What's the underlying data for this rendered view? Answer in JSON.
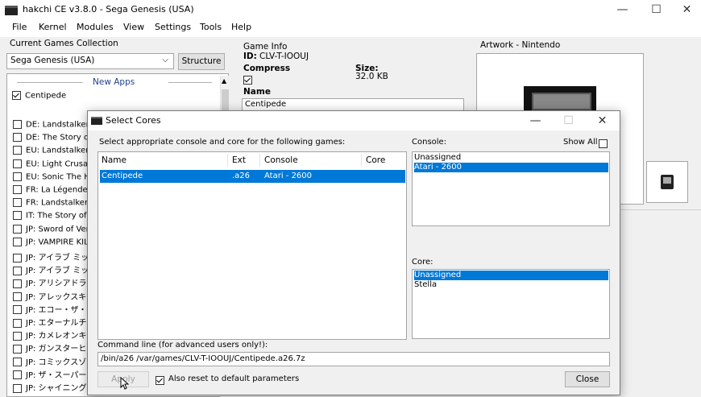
{
  "window": {
    "title": "hakchi CE v3.8.0 - Sega Genesis (USA)",
    "minimize_glyph": "—",
    "maximize_glyph": "☐",
    "close_glyph": "✕"
  },
  "menu": [
    "File",
    "Kernel",
    "Modules",
    "View",
    "Settings",
    "Tools",
    "Help"
  ],
  "collection": {
    "label": "Current Games Collection",
    "selected": "Sega Genesis (USA)",
    "structure_button": "Structure",
    "new_apps_header": "New Apps",
    "new_apps": [
      {
        "name": "Centipede",
        "checked": true
      }
    ],
    "games": [
      "DE: Landstalker",
      "DE: The Story of T",
      "EU: Landstalker",
      "EU: Light Crusade",
      "EU: Sonic The He",
      "FR: La Légende d",
      "FR: Landstalker",
      "IT: The Story of Th",
      "JP: Sword of Verm",
      "JP: VAMPIRE KIL",
      "JP: アイラブ ミッキー",
      "JP: アイラブ ミッキー",
      "JP: アリシアドラグー",
      "JP: アレックスキッド",
      "JP: エコー・ザ・ドル",
      "JP: エターナルチャン",
      "JP: カメレオンキッド",
      "JP: ガンスターヒーロ",
      "JP: コミックスゾーン",
      "JP: ザ・スーパー忍",
      "JP: シャイニング・フ"
    ]
  },
  "game_info": {
    "label": "Game Info",
    "id_label": "ID:",
    "id_value": "CLV-T-IOOUJ",
    "compress_label": "Compress",
    "size_label": "Size:",
    "size_value": "32.0 KB",
    "name_label": "Name",
    "name_value": "Centipede"
  },
  "artwork": {
    "label": "Artwork - Nintendo"
  },
  "dialog": {
    "title": "Select Cores",
    "instruction": "Select appropriate console and core for the following games:",
    "columns": [
      "Name",
      "Ext",
      "Console",
      "Core"
    ],
    "rows": [
      {
        "name": "Centipede",
        "ext": ".a26",
        "console": "Atari - 2600",
        "core": ""
      }
    ],
    "console_label": "Console:",
    "show_all_label": "Show All",
    "consoles": [
      "Unassigned",
      "Atari - 2600"
    ],
    "selected_console": "Atari - 2600",
    "core_label": "Core:",
    "cores": [
      "Unassigned",
      "Stella"
    ],
    "selected_core": "Unassigned",
    "cmdline_label": "Command line (for advanced users only!):",
    "cmdline_value": "/bin/a26 /var/games/CLV-T-IOOUJ/Centipede.a26.7z",
    "apply_button": "Apply",
    "reset_label": "Also reset to default parameters",
    "close_button": "Close",
    "minimize_glyph": "—",
    "maximize_glyph": "☐",
    "close_glyph": "✕"
  }
}
